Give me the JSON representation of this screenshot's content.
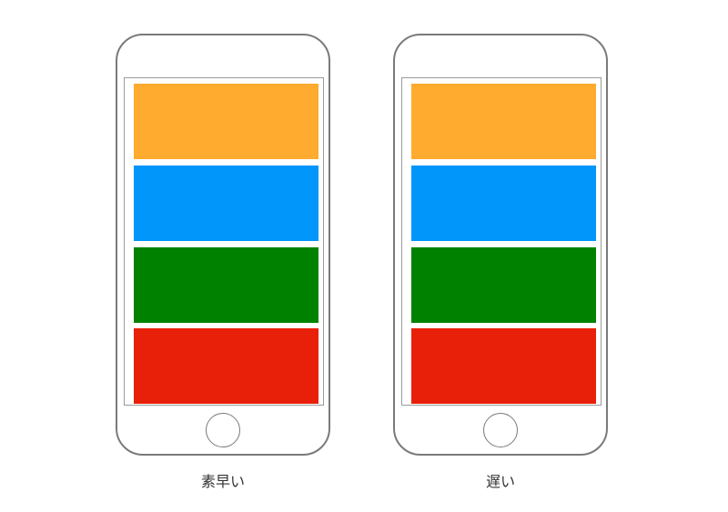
{
  "colors": {
    "orange": "#FEAB2F",
    "blue": "#0096FA",
    "green": "#008200",
    "red": "#E8200A"
  },
  "phones": [
    {
      "caption": "素早い",
      "blocks": [
        "orange",
        "blue",
        "green",
        "red"
      ]
    },
    {
      "caption": "遅い",
      "blocks": [
        "orange",
        "blue",
        "green",
        "red"
      ]
    }
  ]
}
